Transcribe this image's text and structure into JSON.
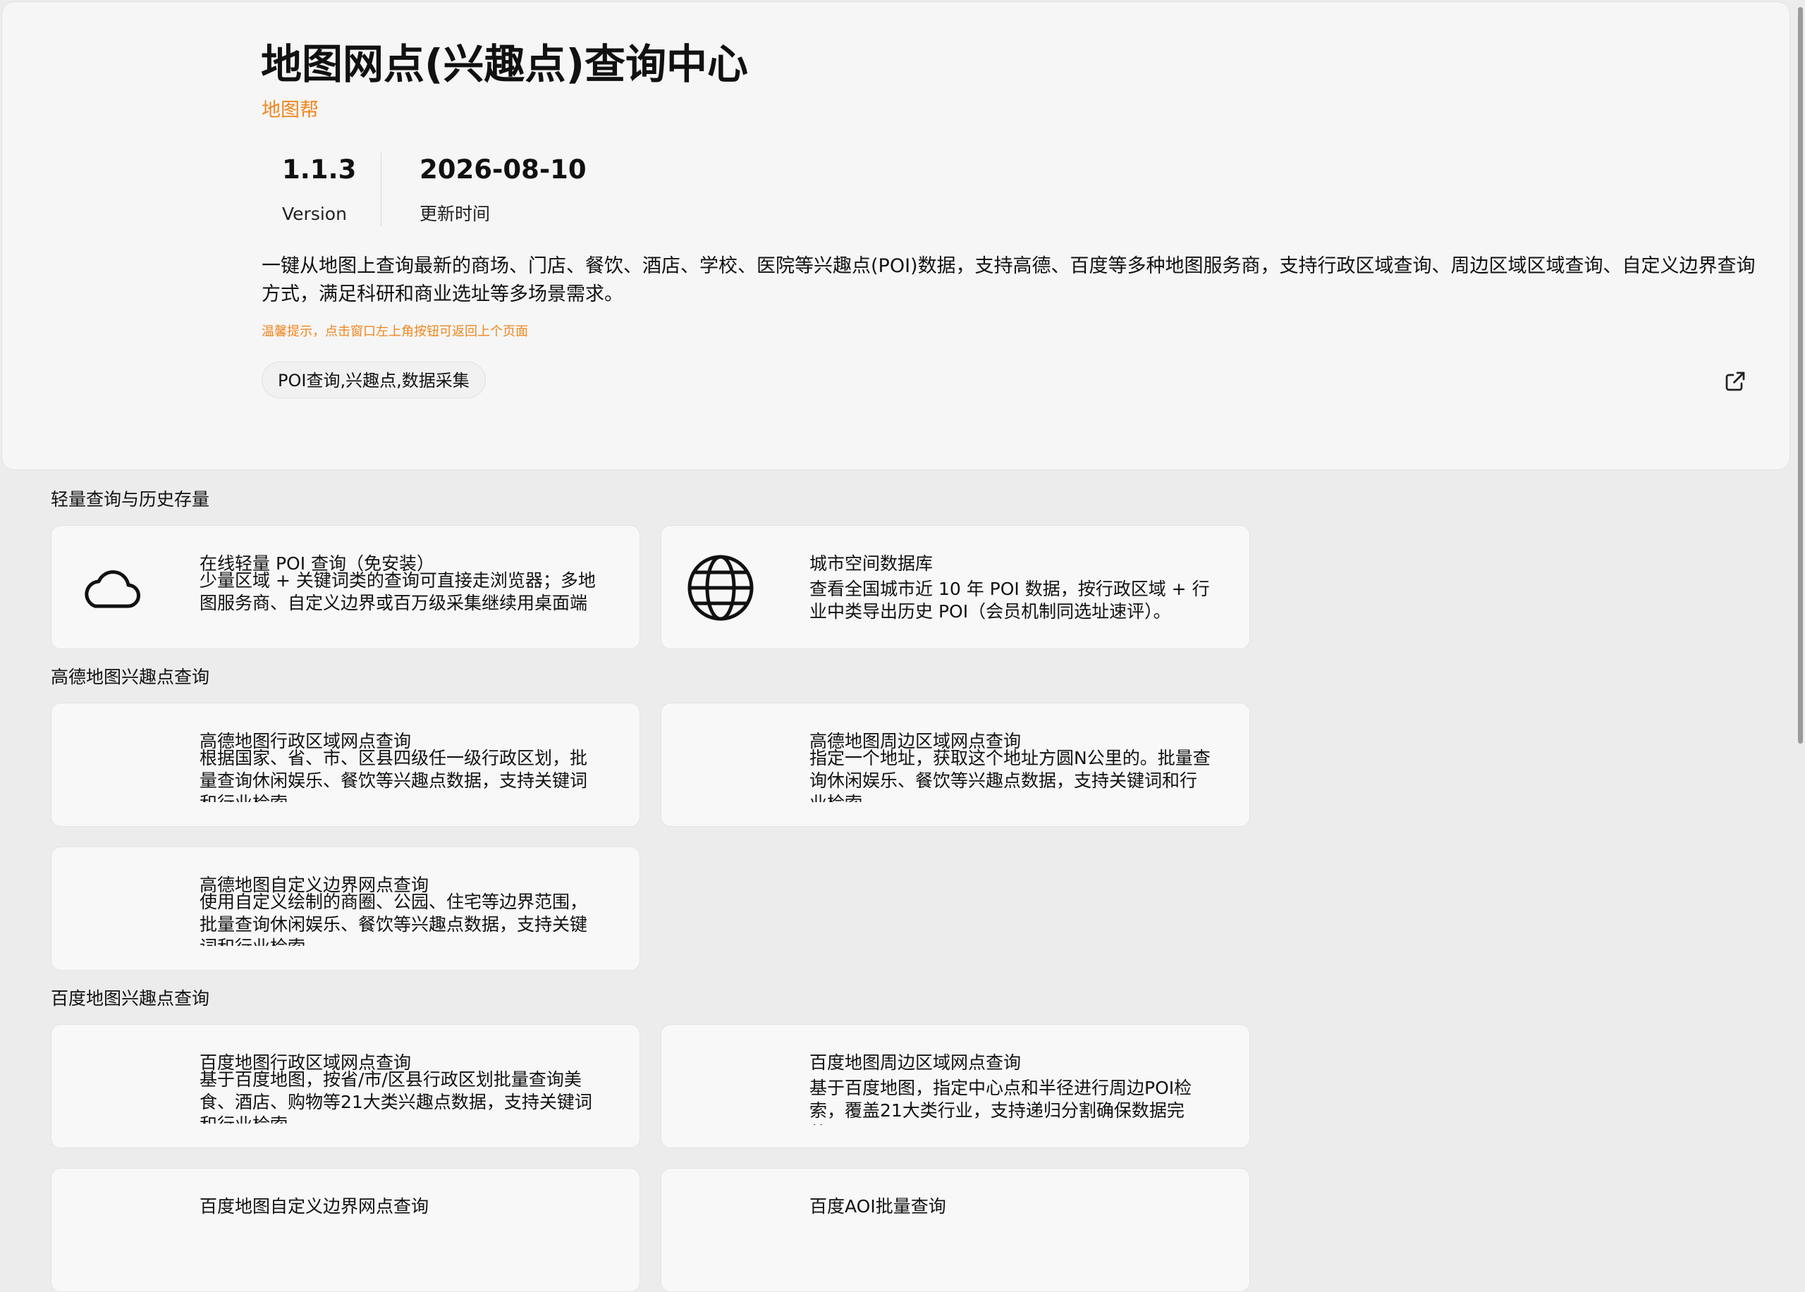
{
  "app": {
    "title": "地图网点(兴趣点)查询中心",
    "developer": "地图帮",
    "version_value": "1.1.3",
    "version_label": "Version",
    "updated_value": "2026-08-10",
    "updated_label": "更新时间",
    "description": "一键从地图上查询最新的商场、门店、餐饮、酒店、学校、医院等兴趣点(POI)数据，支持高德、百度等多种地图服务商，支持行政区域查询、周边区域区域查询、自定义边界查询方式，满足科研和商业选址等多场景需求。",
    "tip": "温馨提示，点击窗口左上角按钮可返回上个页面",
    "tag": "POI查询,兴趣点,数据采集",
    "share_icon": "share-icon",
    "accent_color": "#f0861e"
  },
  "sections": [
    {
      "title": "轻量查询与历史存量",
      "cards": [
        {
          "title": "在线轻量 POI 查询（免安装）",
          "desc": "少量区域 + 关键词类的查询可直接走浏览器；多地图服务商、自定义边界或百万级采集继续用桌面端",
          "icon": "cloud-icon"
        },
        {
          "title": "城市空间数据库",
          "desc": "查看全国城市近 10 年 POI 数据，按行政区域 + 行业中类导出历史 POI（会员机制同选址速评）。",
          "icon": "globe-icon"
        }
      ]
    },
    {
      "title": "高德地图兴趣点查询",
      "cards": [
        {
          "title": "高德地图行政区域网点查询",
          "desc": "根据国家、省、市、区县四级任一级行政区划，批量查询休闲娱乐、餐饮等兴趣点数据，支持关键词和行业检索"
        },
        {
          "title": "高德地图周边区域网点查询",
          "desc": "指定一个地址，获取这个地址方圆N公里的。批量查询休闲娱乐、餐饮等兴趣点数据，支持关键词和行业检索"
        },
        {
          "title": "高德地图自定义边界网点查询",
          "desc": "使用自定义绘制的商圈、公园、住宅等边界范围，批量查询休闲娱乐、餐饮等兴趣点数据，支持关键词和行业检索"
        }
      ]
    },
    {
      "title": "百度地图兴趣点查询",
      "cards": [
        {
          "title": "百度地图行政区域网点查询",
          "desc": "基于百度地图，按省/市/区县行政区划批量查询美食、酒店、购物等21大类兴趣点数据，支持关键词和行业检索"
        },
        {
          "title": "百度地图周边区域网点查询",
          "desc": "基于百度地图，指定中心点和半径进行周边POI检索，覆盖21大类行业，支持递归分割确保数据完整。"
        },
        {
          "title": "百度地图自定义边界网点查询",
          "desc": ""
        },
        {
          "title": "百度AOI批量查询",
          "desc": ""
        }
      ]
    }
  ]
}
